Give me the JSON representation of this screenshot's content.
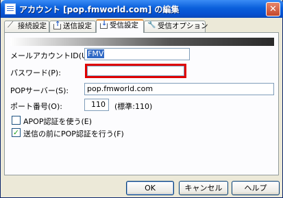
{
  "window": {
    "title": "アカウント [pop.fmworld.com] の編集",
    "close_label": "✕"
  },
  "tabs": [
    {
      "label": "接続設定",
      "icon": "connection-icon",
      "active": false
    },
    {
      "label": "送信設定",
      "icon": "send-icon",
      "active": false
    },
    {
      "label": "受信設定",
      "icon": "receive-icon",
      "active": true
    },
    {
      "label": "受信オプション",
      "icon": "wrench-icon",
      "active": false
    }
  ],
  "form": {
    "account_id": {
      "label": "メールアカウントID(U):",
      "value": "FMV"
    },
    "password": {
      "label": "パスワード(P):",
      "value": ""
    },
    "pop_server": {
      "label": "POPサーバー(S):",
      "value": "pop.fmworld.com"
    },
    "port": {
      "label": "ポート番号(O):",
      "value": "110",
      "note": "(標準:110)"
    },
    "apop": {
      "label": "APOP認証を使う(E)",
      "checked": false
    },
    "pop_before_send": {
      "label": "送信の前にPOP認証を行う(F)",
      "checked": true
    }
  },
  "buttons": {
    "ok": "OK",
    "cancel": "キャンセル",
    "help": "ヘルプ"
  },
  "colors": {
    "highlight": "#e00000",
    "selection": "#316ac5",
    "titlebar": "#0a5fdb"
  }
}
